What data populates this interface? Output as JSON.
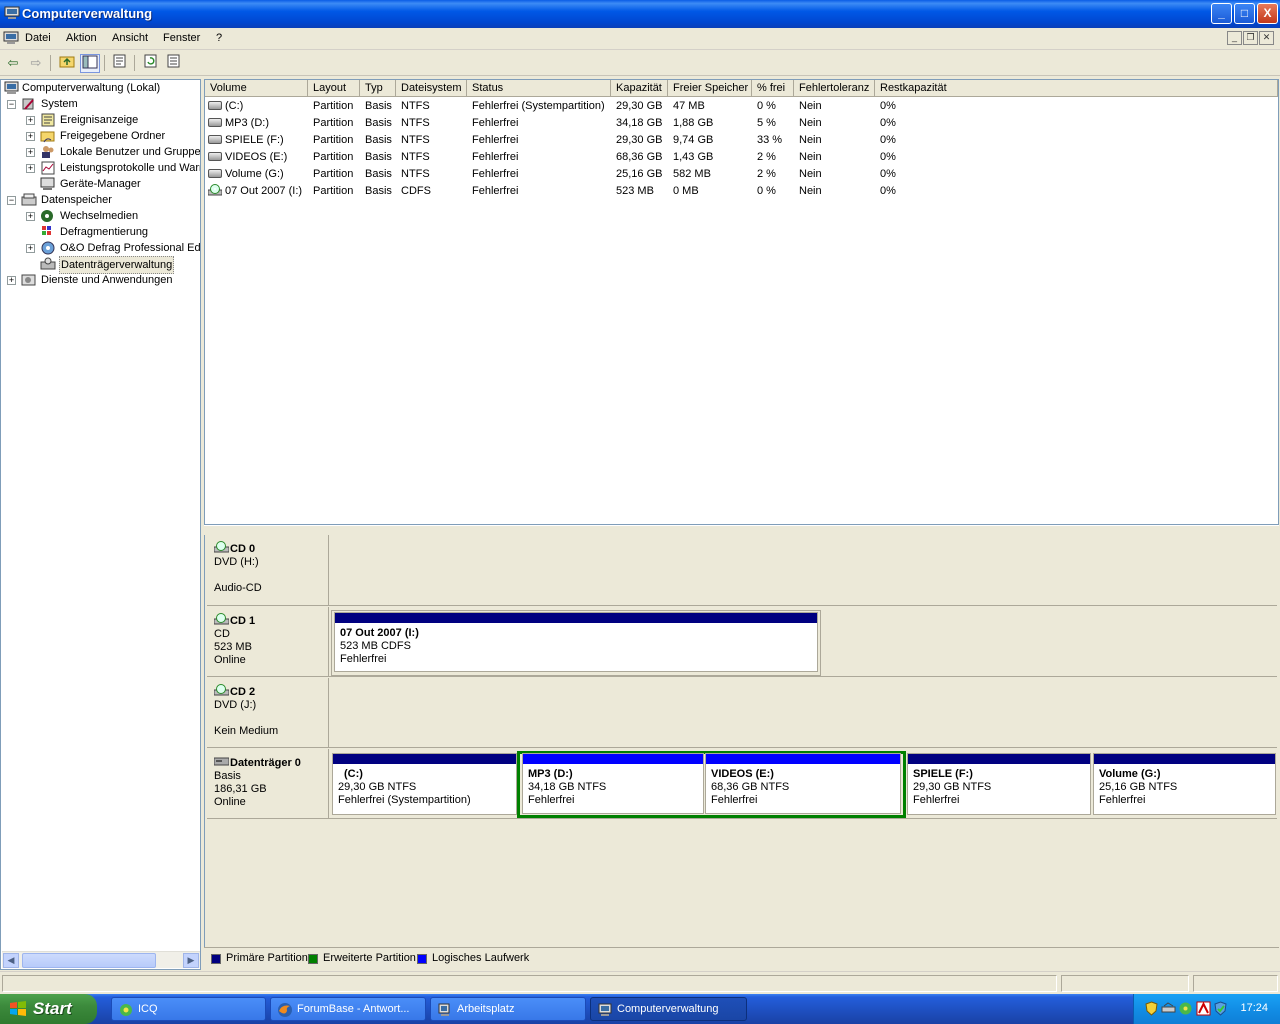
{
  "window": {
    "title": "Computerverwaltung",
    "buttons": {
      "minimize": "_",
      "maximize": "□",
      "close": "X"
    }
  },
  "menu": {
    "items": [
      "Datei",
      "Aktion",
      "Ansicht",
      "Fenster",
      "?"
    ]
  },
  "tree": {
    "root": "Computerverwaltung (Lokal)",
    "system": "System",
    "system_children": [
      "Ereignisanzeige",
      "Freigegebene Ordner",
      "Lokale Benutzer und Gruppen",
      "Leistungsprotokolle und Warnungen",
      "Geräte-Manager"
    ],
    "storage": "Datenspeicher",
    "storage_children": [
      "Wechselmedien",
      "Defragmentierung",
      "O&O Defrag Professional Edition",
      "Datenträgerverwaltung"
    ],
    "services": "Dienste und Anwendungen"
  },
  "volume_list": {
    "columns": [
      "Volume",
      "Layout",
      "Typ",
      "Dateisystem",
      "Status",
      "Kapazität",
      "Freier Speicher",
      "% frei",
      "Fehlertoleranz",
      "Restkapazität"
    ],
    "rows": [
      [
        "(C:)",
        "Partition",
        "Basis",
        "NTFS",
        "Fehlerfrei (Systempartition)",
        "29,30 GB",
        "47 MB",
        "0 %",
        "Nein",
        "0%"
      ],
      [
        "MP3 (D:)",
        "Partition",
        "Basis",
        "NTFS",
        "Fehlerfrei",
        "34,18 GB",
        "1,88 GB",
        "5 %",
        "Nein",
        "0%"
      ],
      [
        "SPIELE (F:)",
        "Partition",
        "Basis",
        "NTFS",
        "Fehlerfrei",
        "29,30 GB",
        "9,74 GB",
        "33 %",
        "Nein",
        "0%"
      ],
      [
        "VIDEOS (E:)",
        "Partition",
        "Basis",
        "NTFS",
        "Fehlerfrei",
        "68,36 GB",
        "1,43 GB",
        "2 %",
        "Nein",
        "0%"
      ],
      [
        "Volume (G:)",
        "Partition",
        "Basis",
        "NTFS",
        "Fehlerfrei",
        "25,16 GB",
        "582 MB",
        "2 %",
        "Nein",
        "0%"
      ],
      [
        "07 Out 2007 (I:)",
        "Partition",
        "Basis",
        "CDFS",
        "Fehlerfrei",
        "523 MB",
        "0 MB",
        "0 %",
        "Nein",
        "0%"
      ]
    ]
  },
  "disks": [
    {
      "name": "CD 0",
      "line1": "DVD (H:)",
      "line2": "",
      "line3": "Audio-CD",
      "volumes": []
    },
    {
      "name": "CD 1",
      "line1": "CD",
      "line2": "523 MB",
      "line3": "Online",
      "volumes": [
        {
          "title": "07 Out 2007  (I:)",
          "size": "523 MB CDFS",
          "status": "Fehlerfrei"
        }
      ]
    },
    {
      "name": "CD 2",
      "line1": "DVD (J:)",
      "line2": "",
      "line3": "Kein Medium",
      "volumes": []
    },
    {
      "name": "Datenträger 0",
      "line1": "Basis",
      "line2": "186,31 GB",
      "line3": "Online",
      "volumes": [
        {
          "title": "(C:)",
          "size": "29,30 GB NTFS",
          "status": "Fehlerfrei (Systempartition)"
        },
        {
          "title": "MP3  (D:)",
          "size": "34,18 GB NTFS",
          "status": "Fehlerfrei"
        },
        {
          "title": "VIDEOS  (E:)",
          "size": "68,36 GB NTFS",
          "status": "Fehlerfrei"
        },
        {
          "title": "SPIELE  (F:)",
          "size": "29,30 GB NTFS",
          "status": "Fehlerfrei"
        },
        {
          "title": "Volume  (G:)",
          "size": "25,16 GB NTFS",
          "status": "Fehlerfrei"
        }
      ]
    }
  ],
  "legend": [
    "Primäre Partition",
    "Erweiterte Partition",
    "Logisches Laufwerk"
  ],
  "colors": {
    "primary": "#000080",
    "extended": "#008000",
    "logical": "#0000ff"
  },
  "taskbar": {
    "start": "Start",
    "items": [
      "ICQ",
      "ForumBase - Antwort...",
      "Arbeitsplatz",
      "Computerverwaltung"
    ],
    "clock": "17:24"
  }
}
